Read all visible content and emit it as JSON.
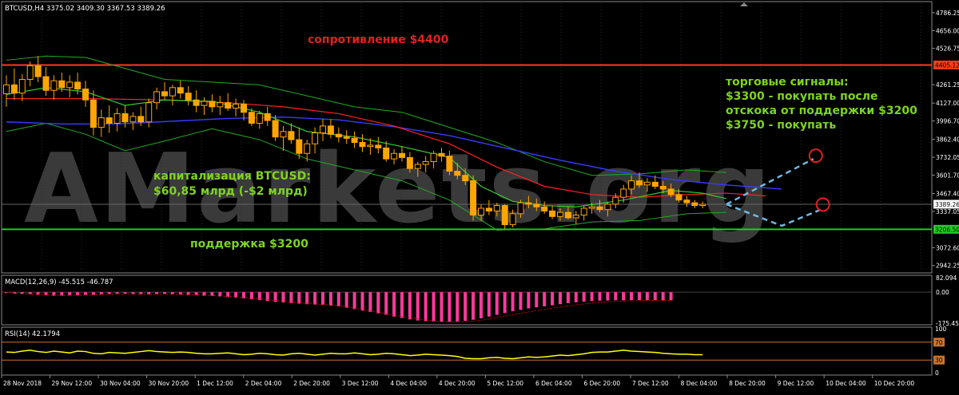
{
  "header": {
    "symbol_info": "BTCUSD,H4  3375.02 3409.30 3367.53 3389.26"
  },
  "watermark": "AMarkets.org",
  "colors": {
    "background": "#000000",
    "grid": "#2a2a2a",
    "candle": "#ffa500",
    "resistance": "#ff3b1a",
    "support": "#22cc22",
    "ma_blue": "#3a3aff",
    "ma_red": "#ff2020",
    "ma_green": "#33cc33",
    "bollinger": "#22aa22",
    "macd_hist": "#ff3a9a",
    "macd_signal": "#cc0000",
    "rsi": "#ffff00",
    "rsi_levels": "#c9742c",
    "annotation_red": "#e02020",
    "annotation_green": "#7ed321",
    "arrow": "#6fb7e0",
    "axis_text": "#ffffff"
  },
  "annotations": {
    "resistance_label": "сопротивление $4400",
    "support_label": "поддержка $3200",
    "cap_line1": "капитализация BTCUSD:",
    "cap_line2": "$60,85 млрд (-$2 млрд)",
    "signals_line1": "торговые сигналы:",
    "signals_line2": "$3300 - покупать после",
    "signals_line3": "отскока от поддержки $3200",
    "signals_line4": "$3750 - покупать"
  },
  "price_axis": {
    "ticks": [
      "4786.25",
      "4656.00",
      "4526.75",
      "4405.12",
      "4261.25",
      "4127.00",
      "3996.70",
      "3862.40",
      "3732.05",
      "3601.70",
      "3467.40",
      "3389.26",
      "3337.05",
      "3206.50",
      "3072.60",
      "2942.25"
    ],
    "resistance_tag": "4405.12",
    "support_tag": "3206.50",
    "current_tag": "3389.26"
  },
  "time_axis": {
    "labels": [
      "28 Nov 2018",
      "29 Nov 12:00",
      "30 Nov 04:00",
      "30 Nov 20:00",
      "1 Dec 12:00",
      "2 Dec 04:00",
      "2 Dec 20:00",
      "3 Dec 12:00",
      "4 Dec 04:00",
      "4 Dec 20:00",
      "5 Dec 12:00",
      "6 Dec 04:00",
      "6 Dec 20:00",
      "7 Dec 12:00",
      "8 Dec 04:00",
      "8 Dec 20:00",
      "9 Dec 12:00",
      "10 Dec 04:00",
      "10 Dec 20:00"
    ]
  },
  "macd_panel": {
    "label": "MACD(12,26,9) -45.515 -46.787",
    "ticks": [
      "82.094",
      "0.00",
      "-175.458"
    ]
  },
  "rsi_panel": {
    "label": "RSI(14) 42.1794",
    "ticks": [
      "100",
      "70",
      "30",
      "0"
    ]
  },
  "chart_data": {
    "type": "candlestick",
    "symbol": "BTCUSD",
    "timeframe": "H4",
    "ylim": [
      2900,
      4850
    ],
    "resistance": 4405,
    "support": 3206,
    "last_price": 3389.26,
    "macd_ylim": [
      -175.458,
      82.094
    ],
    "rsi_ylim": [
      0,
      100
    ],
    "rsi_levels": [
      30,
      70
    ],
    "candles": [
      [
        4195,
        4330,
        4100,
        4260
      ],
      [
        4260,
        4380,
        4150,
        4200
      ],
      [
        4200,
        4340,
        4140,
        4300
      ],
      [
        4300,
        4430,
        4250,
        4400
      ],
      [
        4400,
        4470,
        4280,
        4320
      ],
      [
        4320,
        4390,
        4180,
        4220
      ],
      [
        4220,
        4330,
        4150,
        4290
      ],
      [
        4290,
        4350,
        4210,
        4240
      ],
      [
        4240,
        4330,
        4170,
        4280
      ],
      [
        4280,
        4350,
        4190,
        4230
      ],
      [
        4230,
        4290,
        4100,
        4150
      ],
      [
        4150,
        4220,
        3890,
        3950
      ],
      [
        3950,
        4080,
        3880,
        4020
      ],
      [
        4020,
        4110,
        3910,
        3980
      ],
      [
        3980,
        4090,
        3920,
        4050
      ],
      [
        4050,
        4110,
        3950,
        3990
      ],
      [
        3990,
        4060,
        3930,
        4030
      ],
      [
        4030,
        4100,
        3960,
        3990
      ],
      [
        3990,
        4160,
        3950,
        4130
      ],
      [
        4130,
        4240,
        4080,
        4210
      ],
      [
        4210,
        4280,
        4150,
        4180
      ],
      [
        4180,
        4260,
        4110,
        4240
      ],
      [
        4240,
        4290,
        4160,
        4200
      ],
      [
        4200,
        4250,
        4110,
        4150
      ],
      [
        4150,
        4220,
        4060,
        4110
      ],
      [
        4110,
        4170,
        4040,
        4140
      ],
      [
        4140,
        4190,
        4060,
        4100
      ],
      [
        4100,
        4180,
        4040,
        4130
      ],
      [
        4130,
        4200,
        4070,
        4090
      ],
      [
        4090,
        4160,
        4030,
        4120
      ],
      [
        4120,
        4150,
        4000,
        4060
      ],
      [
        4060,
        4090,
        3960,
        3980
      ],
      [
        3980,
        4070,
        3940,
        4050
      ],
      [
        4050,
        4100,
        3960,
        4000
      ],
      [
        4000,
        4040,
        3850,
        3880
      ],
      [
        3880,
        3960,
        3780,
        3920
      ],
      [
        3920,
        3980,
        3830,
        3860
      ],
      [
        3860,
        3950,
        3720,
        3760
      ],
      [
        3760,
        3860,
        3700,
        3830
      ],
      [
        3830,
        3950,
        3760,
        3910
      ],
      [
        3910,
        4010,
        3850,
        3960
      ],
      [
        3960,
        4010,
        3870,
        3900
      ],
      [
        3900,
        3950,
        3840,
        3880
      ],
      [
        3880,
        3930,
        3830,
        3870
      ],
      [
        3870,
        3920,
        3800,
        3840
      ],
      [
        3840,
        3900,
        3770,
        3810
      ],
      [
        3810,
        3870,
        3750,
        3820
      ],
      [
        3820,
        3880,
        3760,
        3800
      ],
      [
        3800,
        3850,
        3700,
        3720
      ],
      [
        3720,
        3790,
        3680,
        3760
      ],
      [
        3760,
        3810,
        3700,
        3730
      ],
      [
        3730,
        3770,
        3620,
        3650
      ],
      [
        3650,
        3700,
        3590,
        3680
      ],
      [
        3680,
        3740,
        3620,
        3700
      ],
      [
        3700,
        3780,
        3650,
        3760
      ],
      [
        3760,
        3800,
        3700,
        3740
      ],
      [
        3740,
        3780,
        3600,
        3630
      ],
      [
        3630,
        3690,
        3570,
        3600
      ],
      [
        3600,
        3650,
        3530,
        3560
      ],
      [
        3560,
        3600,
        3270,
        3310
      ],
      [
        3310,
        3390,
        3270,
        3360
      ],
      [
        3360,
        3420,
        3310,
        3340
      ],
      [
        3340,
        3400,
        3300,
        3380
      ],
      [
        3380,
        3390,
        3210,
        3240
      ],
      [
        3240,
        3350,
        3220,
        3320
      ],
      [
        3320,
        3420,
        3290,
        3400
      ],
      [
        3400,
        3450,
        3360,
        3390
      ],
      [
        3390,
        3430,
        3340,
        3370
      ],
      [
        3370,
        3410,
        3320,
        3340
      ],
      [
        3340,
        3380,
        3280,
        3300
      ],
      [
        3300,
        3360,
        3270,
        3330
      ],
      [
        3330,
        3370,
        3280,
        3290
      ],
      [
        3290,
        3340,
        3240,
        3310
      ],
      [
        3310,
        3380,
        3270,
        3360
      ],
      [
        3360,
        3400,
        3320,
        3370
      ],
      [
        3370,
        3420,
        3330,
        3350
      ],
      [
        3350,
        3400,
        3300,
        3390
      ],
      [
        3390,
        3470,
        3360,
        3440
      ],
      [
        3440,
        3530,
        3400,
        3500
      ],
      [
        3500,
        3600,
        3460,
        3560
      ],
      [
        3560,
        3620,
        3510,
        3530
      ],
      [
        3530,
        3580,
        3480,
        3550
      ],
      [
        3550,
        3600,
        3500,
        3520
      ],
      [
        3520,
        3560,
        3470,
        3500
      ],
      [
        3500,
        3540,
        3440,
        3460
      ],
      [
        3460,
        3500,
        3400,
        3420
      ],
      [
        3420,
        3450,
        3370,
        3400
      ],
      [
        3400,
        3420,
        3360,
        3380
      ],
      [
        3380,
        3410,
        3360,
        3389
      ]
    ],
    "ma_blue": [
      [
        0,
        3990
      ],
      [
        7,
        3975
      ],
      [
        14,
        3975
      ],
      [
        21,
        3995
      ],
      [
        28,
        4015
      ],
      [
        35,
        4025
      ],
      [
        42,
        4005
      ],
      [
        49,
        3955
      ],
      [
        56,
        3890
      ],
      [
        63,
        3800
      ],
      [
        70,
        3710
      ],
      [
        77,
        3630
      ],
      [
        84,
        3570
      ],
      [
        91,
        3530
      ],
      [
        98,
        3500
      ]
    ],
    "ma_red": [
      [
        0,
        4160
      ],
      [
        10,
        4160
      ],
      [
        20,
        4150
      ],
      [
        28,
        4130
      ],
      [
        35,
        4100
      ],
      [
        42,
        4050
      ],
      [
        49,
        3960
      ],
      [
        56,
        3830
      ],
      [
        62,
        3660
      ],
      [
        68,
        3520
      ],
      [
        74,
        3460
      ],
      [
        80,
        3440
      ],
      [
        86,
        3460
      ],
      [
        91,
        3470
      ],
      [
        96,
        3450
      ]
    ],
    "ma_green": [
      [
        0,
        4190
      ],
      [
        5,
        4240
      ],
      [
        10,
        4210
      ],
      [
        15,
        4110
      ],
      [
        20,
        4150
      ],
      [
        26,
        4140
      ],
      [
        32,
        4060
      ],
      [
        38,
        3920
      ],
      [
        44,
        3880
      ],
      [
        50,
        3810
      ],
      [
        56,
        3730
      ],
      [
        60,
        3520
      ],
      [
        64,
        3410
      ],
      [
        68,
        3380
      ],
      [
        72,
        3370
      ],
      [
        78,
        3420
      ],
      [
        84,
        3490
      ],
      [
        88,
        3470
      ],
      [
        91,
        3430
      ]
    ],
    "bb_upper": [
      [
        0,
        4440
      ],
      [
        5,
        4470
      ],
      [
        10,
        4460
      ],
      [
        15,
        4380
      ],
      [
        20,
        4300
      ],
      [
        26,
        4280
      ],
      [
        32,
        4260
      ],
      [
        38,
        4180
      ],
      [
        44,
        4100
      ],
      [
        50,
        4060
      ],
      [
        56,
        3950
      ],
      [
        62,
        3840
      ],
      [
        68,
        3700
      ],
      [
        74,
        3600
      ],
      [
        80,
        3610
      ],
      [
        86,
        3640
      ],
      [
        91,
        3620
      ]
    ],
    "bb_lower": [
      [
        0,
        3920
      ],
      [
        5,
        3980
      ],
      [
        10,
        3900
      ],
      [
        15,
        3780
      ],
      [
        20,
        3850
      ],
      [
        26,
        3940
      ],
      [
        32,
        3860
      ],
      [
        38,
        3720
      ],
      [
        44,
        3640
      ],
      [
        50,
        3560
      ],
      [
        56,
        3420
      ],
      [
        62,
        3200
      ],
      [
        68,
        3210
      ],
      [
        74,
        3260
      ],
      [
        80,
        3270
      ],
      [
        86,
        3320
      ],
      [
        91,
        3330
      ]
    ],
    "forecast": [
      [
        91,
        3389
      ],
      [
        98,
        3232
      ],
      [
        103,
        3352
      ]
    ],
    "forecast_up": [
      [
        91,
        3389
      ],
      [
        102,
        3720
      ]
    ],
    "macd": [
      -5,
      -8,
      -10,
      -12,
      -15,
      -18,
      -20,
      -20,
      -18,
      -18,
      -15,
      -15,
      -12,
      -10,
      -8,
      -8,
      -10,
      -12,
      -12,
      -10,
      -10,
      -12,
      -14,
      -16,
      -18,
      -20,
      -22,
      -24,
      -28,
      -30,
      -35,
      -40,
      -45,
      -50,
      -55,
      -58,
      -62,
      -65,
      -68,
      -70,
      -72,
      -76,
      -80,
      -88,
      -96,
      -104,
      -112,
      -120,
      -128,
      -138,
      -146,
      -154,
      -160,
      -164,
      -166,
      -168,
      -168,
      -166,
      -162,
      -156,
      -148,
      -138,
      -128,
      -118,
      -108,
      -100,
      -92,
      -86,
      -80,
      -74,
      -68,
      -62,
      -57,
      -53,
      -50,
      -48,
      -47,
      -46,
      -46,
      -45,
      -45,
      -45,
      -45,
      -46,
      -46
    ],
    "macd_signal": [
      -2,
      -5,
      -8,
      -10,
      -12,
      -14,
      -16,
      -18,
      -18,
      -18,
      -16,
      -15,
      -14,
      -12,
      -11,
      -10,
      -10,
      -11,
      -12,
      -12,
      -11,
      -11,
      -12,
      -13,
      -15,
      -17,
      -19,
      -21,
      -24,
      -27,
      -30,
      -34,
      -38,
      -42,
      -47,
      -51,
      -55,
      -59,
      -62,
      -66,
      -70,
      -74,
      -78,
      -84,
      -90,
      -98,
      -106,
      -114,
      -122,
      -130,
      -138,
      -145,
      -152,
      -158,
      -163,
      -166,
      -168,
      -168,
      -167,
      -164,
      -159,
      -152,
      -144,
      -136,
      -128,
      -120,
      -112,
      -104,
      -97,
      -90,
      -84,
      -78,
      -72,
      -67,
      -62,
      -58,
      -55,
      -52,
      -50,
      -49,
      -48,
      -47,
      -47,
      -47,
      -47
    ],
    "rsi": [
      48,
      47,
      50,
      52,
      49,
      47,
      50,
      48,
      46,
      50,
      49,
      45,
      44,
      47,
      46,
      45,
      47,
      49,
      51,
      49,
      48,
      47,
      48,
      47,
      45,
      44,
      44,
      45,
      46,
      44,
      42,
      43,
      45,
      44,
      42,
      41,
      44,
      45,
      43,
      41,
      43,
      45,
      44,
      44,
      46,
      44,
      42,
      43,
      45,
      44,
      42,
      40,
      41,
      43,
      42,
      41,
      40,
      38,
      34,
      33,
      33,
      35,
      36,
      34,
      33,
      35,
      37,
      36,
      37,
      39,
      41,
      40,
      42,
      44,
      47,
      48,
      48,
      50,
      52,
      50,
      49,
      48,
      47,
      45,
      44,
      43,
      43,
      42,
      42
    ]
  }
}
